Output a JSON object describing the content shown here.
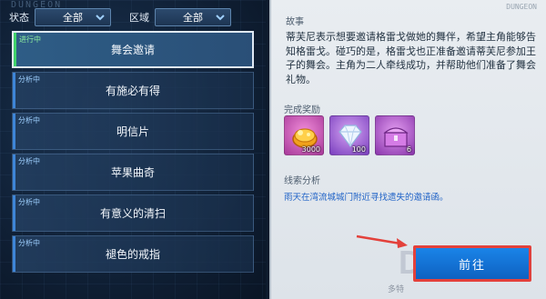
{
  "bg_word": "DUNGEON",
  "filters": {
    "status_label": "状态",
    "status_value": "全部",
    "region_label": "区域",
    "region_value": "全部"
  },
  "quests": [
    {
      "status": "进行中",
      "name": "舞会邀请",
      "active": true
    },
    {
      "status": "分析中",
      "name": "有施必有得",
      "active": false
    },
    {
      "status": "分析中",
      "name": "明信片",
      "active": false
    },
    {
      "status": "分析中",
      "name": "苹果曲奇",
      "active": false
    },
    {
      "status": "分析中",
      "name": "有意义的清扫",
      "active": false
    },
    {
      "status": "分析中",
      "name": "褪色的戒指",
      "active": false
    }
  ],
  "detail": {
    "top_watermark": "DUNGEON",
    "story_title": "故事",
    "story_text": "蒂芙尼表示想要邀请格雷戈做她的舞伴，希望主角能够告知格雷戈。碰巧的是，格雷戈也正准备邀请蒂芙尼参加王子的舞会。主角为二人牵线成功，并帮助他们准备了舞会礼物。",
    "reward_title": "完成奖励",
    "rewards": [
      {
        "icon": "gold-coins-icon",
        "count": "3000"
      },
      {
        "icon": "diamond-icon",
        "count": "100"
      },
      {
        "icon": "treasure-chest-icon",
        "count": "6"
      }
    ],
    "clue_title": "线索分析",
    "clue_text": "雨天在湾流城城门附近寻找遗失的邀请函。",
    "go_label": "前往",
    "watermark_logo": "DuoTe",
    "watermark_sub": "多特"
  },
  "colors": {
    "active_bar": "#3fd16a",
    "status_bar": "#3e86d8",
    "go_button": "#1a84e8",
    "highlight_border": "#e3413b",
    "clue_text": "#1f62c7"
  }
}
